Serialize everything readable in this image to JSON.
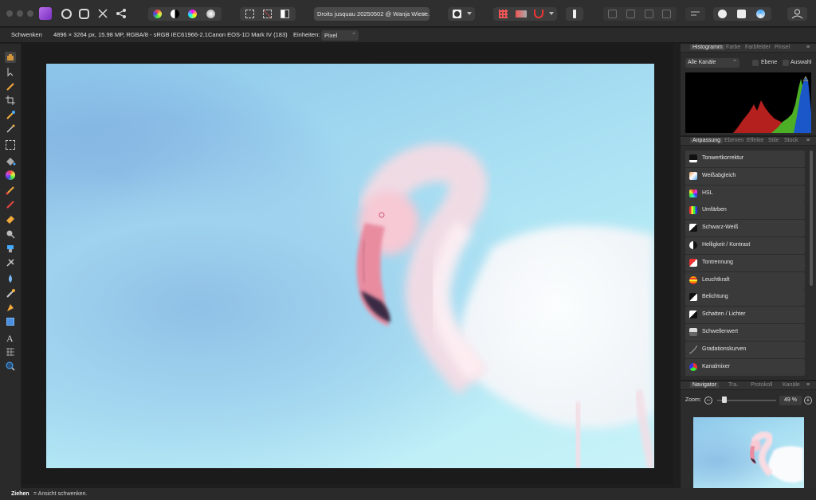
{
  "document": {
    "title": "Droits jusquau 20250502 @ Wanja Wiese.",
    "close_glyph": "✕"
  },
  "context_toolbar": {
    "tool_name": "Schwenken",
    "image_info": "4896 × 3264 px, 15.98 MP, RGBA/8 - sRGB IEC61966-2.1",
    "camera": "Canon EOS-1D Mark IV (183)",
    "units_label": "Einheiten:",
    "units_value": "Pixel"
  },
  "histogram_panel": {
    "tabs": [
      "Histogramm",
      "Farbe",
      "Farbfelder",
      "Pinsel"
    ],
    "channel_select": "Alle Kanäle",
    "layer_checkbox": "Ebene",
    "selection_checkbox": "Auswahl",
    "warning_glyph": "⚠"
  },
  "adjustment_panel": {
    "tabs": [
      "Anpassung",
      "Ebenen",
      "Effekte",
      "Stile",
      "Stock"
    ],
    "items": [
      {
        "label": "Tonwertkorrektur",
        "icon": "levels-icon"
      },
      {
        "label": "Weißabgleich",
        "icon": "white-balance-icon"
      },
      {
        "label": "HSL",
        "icon": "hsl-icon"
      },
      {
        "label": "Umfärben",
        "icon": "recolor-icon"
      },
      {
        "label": "Schwarz-Weiß",
        "icon": "black-white-icon"
      },
      {
        "label": "Helligkeit / Kontrast",
        "icon": "brightness-contrast-icon"
      },
      {
        "label": "Tontrennung",
        "icon": "posterize-icon"
      },
      {
        "label": "Leuchtkraft",
        "icon": "vibrance-icon"
      },
      {
        "label": "Belichtung",
        "icon": "exposure-icon"
      },
      {
        "label": "Schatten / Lichter",
        "icon": "shadows-highlights-icon"
      },
      {
        "label": "Schwellenwert",
        "icon": "threshold-icon"
      },
      {
        "label": "Gradationskurven",
        "icon": "curves-icon"
      },
      {
        "label": "Kanalmixer",
        "icon": "channel-mixer-icon"
      }
    ]
  },
  "navigator_panel": {
    "tabs": [
      "Navigator",
      "Tra.",
      "Protokoll",
      "Kanäle"
    ],
    "zoom_label": "Zoom:",
    "zoom_value": "49 %",
    "zoom_fraction": 0.12,
    "zoom_minus": "−",
    "zoom_plus": "+"
  },
  "statusbar": {
    "key": "Ziehen",
    "text": " = Ansicht schwenken."
  },
  "menu_glyph": "≡",
  "colors": {
    "accent": "#9b4fd1",
    "panel_bg": "#2c2c2c",
    "toolbar_bg": "#2f2f2f"
  }
}
